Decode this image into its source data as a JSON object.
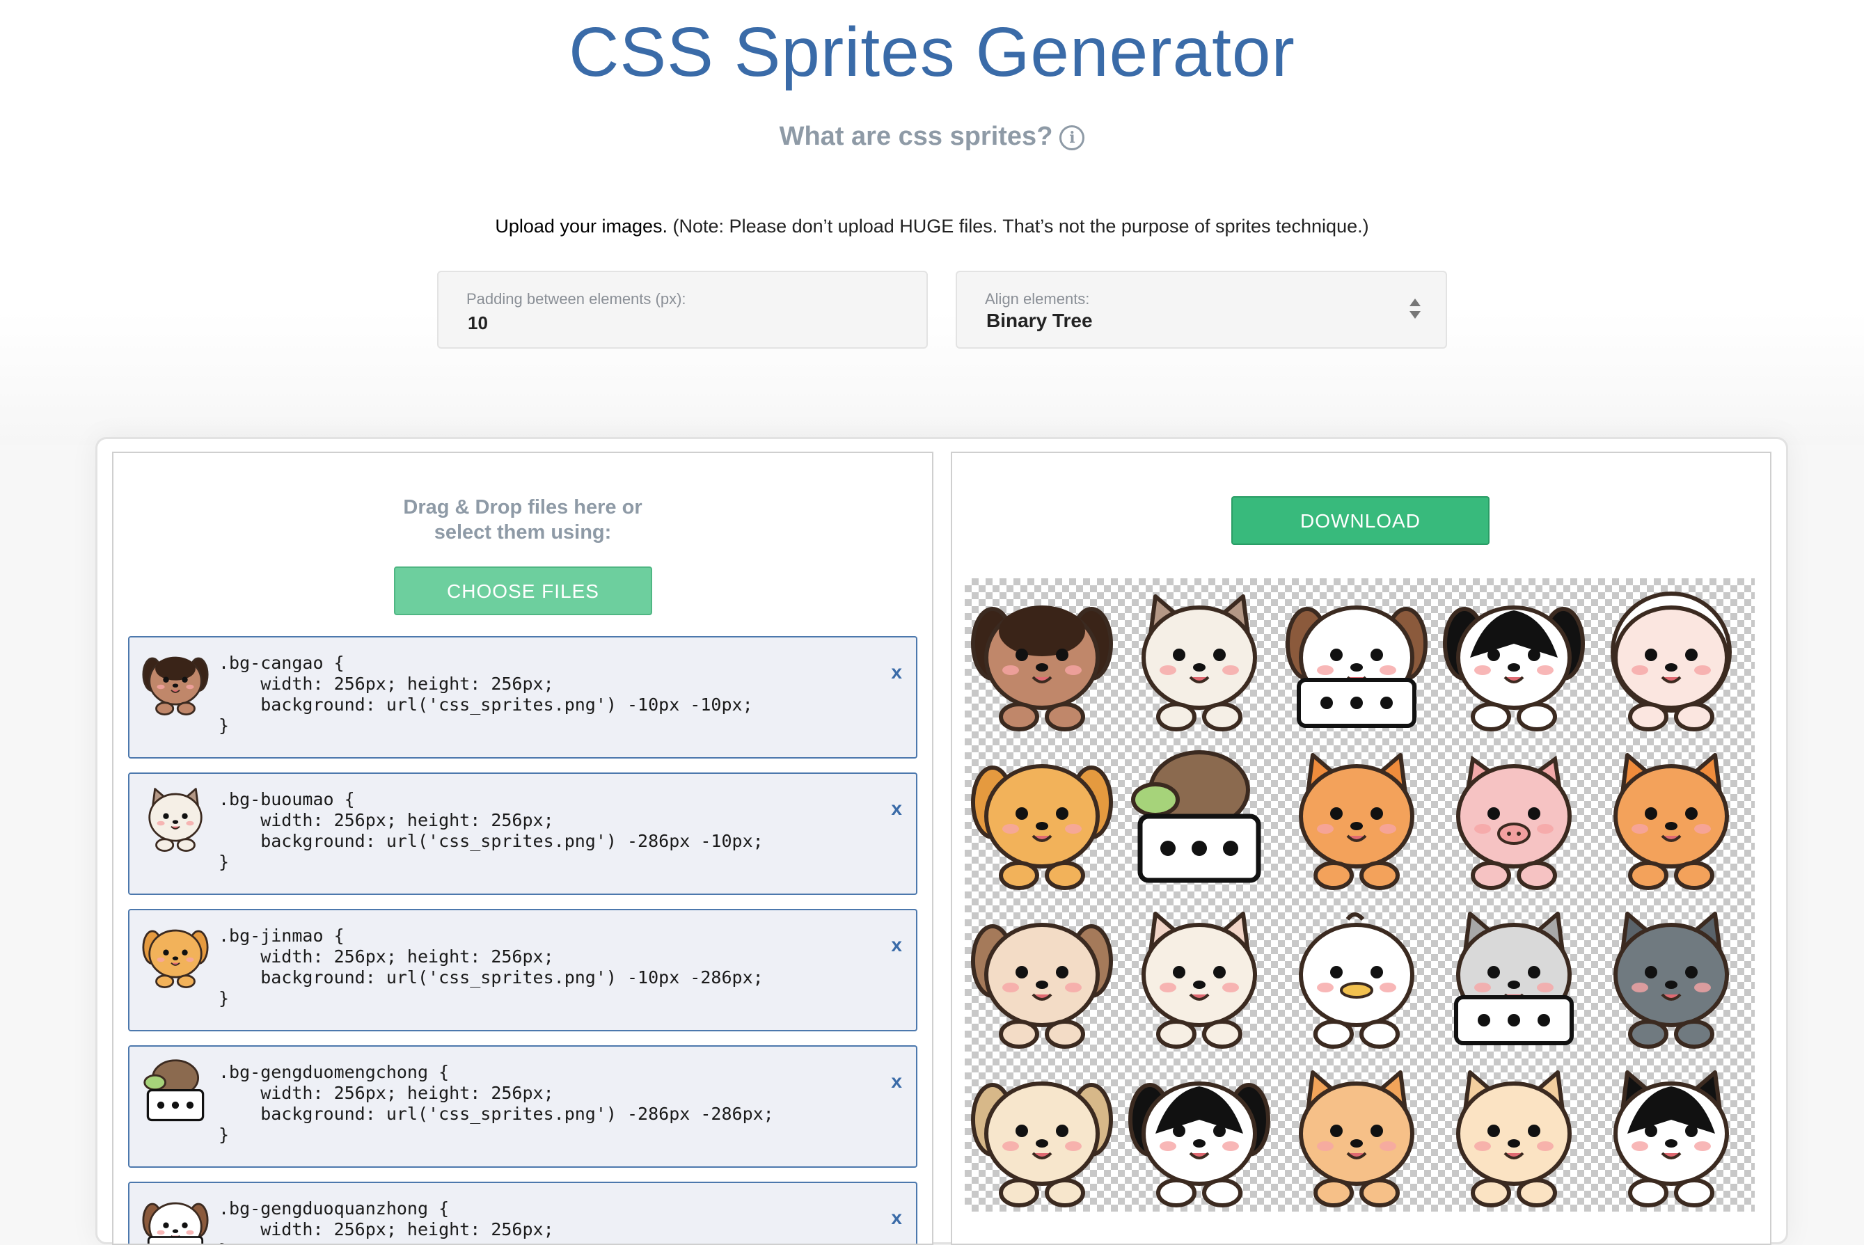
{
  "header": {
    "title": "CSS Sprites Generator",
    "subtitle": "What are css sprites?",
    "note_strong": "Upload your images.",
    "note_rest": " (Note: Please don’t upload HUGE files. That’s not the purpose of sprites technique.)"
  },
  "settings": {
    "padding_label": "Padding between elements (px):",
    "padding_value": "10",
    "align_label": "Align elements:",
    "align_value": "Binary Tree"
  },
  "upload_panel": {
    "drop_line1": "Drag & Drop files here or",
    "drop_line2": "select them using:",
    "choose_button": "CHOOSE FILES",
    "remove_label": "x",
    "items": [
      {
        "icon": "rottweiler-puppy-icon",
        "code": ".bg-cangao {\n    width: 256px; height: 256px;\n    background: url('css_sprites.png') -10px -10px;\n}"
      },
      {
        "icon": "ragdoll-cat-icon",
        "code": ".bg-buoumao {\n    width: 256px; height: 256px;\n    background: url('css_sprites.png') -286px -10px;\n}"
      },
      {
        "icon": "golden-retriever-icon",
        "code": ".bg-jinmao {\n    width: 256px; height: 256px;\n    background: url('css_sprites.png') -10px -286px;\n}"
      },
      {
        "icon": "turtle-icon",
        "code": ".bg-gengduomengchong {\n    width: 256px; height: 256px;\n    background: url('css_sprites.png') -286px -286px;\n}"
      },
      {
        "icon": "puppy-icon",
        "code": ".bg-gengduoquanzhong {\n    width: 256px; height: 256px;\n}"
      }
    ]
  },
  "preview_panel": {
    "download_button": "DOWNLOAD",
    "sprites": [
      {
        "name": "rottweiler-sprite",
        "kind": "dog",
        "face": "#c0876a",
        "ear": "#3a2418",
        "dark": true
      },
      {
        "name": "ragdoll-cat-sprite",
        "kind": "cat",
        "face": "#f5efe6",
        "ear": "#b49886"
      },
      {
        "name": "beagle-sprite",
        "kind": "box-dog",
        "face": "#ffffff",
        "ear": "#8b5a3c"
      },
      {
        "name": "husky-sprite",
        "kind": "dog",
        "face": "#ffffff",
        "ear": "#111111",
        "mask": true
      },
      {
        "name": "sheep-sprite",
        "kind": "sheep",
        "face": "#fbe6e0",
        "ear": "#ffffff"
      },
      {
        "name": "golden-retriever-sprite",
        "kind": "dog",
        "face": "#f2b25a",
        "ear": "#e59a3f"
      },
      {
        "name": "turtle-sprite",
        "kind": "turtle",
        "face": "#8b6a4f",
        "ear": "#a6d37a"
      },
      {
        "name": "shiba-sprite",
        "kind": "fox",
        "face": "#f3a25b",
        "ear": "#f08c3c"
      },
      {
        "name": "pig-sprite",
        "kind": "pig",
        "face": "#f6c3c3",
        "ear": "#f2a9a9"
      },
      {
        "name": "corgi-sprite",
        "kind": "fox",
        "face": "#f3a25b",
        "ear": "#f08c3c"
      },
      {
        "name": "brown-dog-sprite",
        "kind": "dog",
        "face": "#f3dcc6",
        "ear": "#a57a5a"
      },
      {
        "name": "bulldog-sprite",
        "kind": "cat",
        "face": "#f7efe4",
        "ear": "#f2d5c8"
      },
      {
        "name": "duck-sprite",
        "kind": "duck",
        "face": "#ffffff",
        "ear": "#f2c14f"
      },
      {
        "name": "tabby-box-sprite",
        "kind": "box-cat",
        "face": "#d9d9d9",
        "ear": "#a8a8a8"
      },
      {
        "name": "gray-cat-sprite",
        "kind": "cat",
        "face": "#707a80",
        "ear": "#5a636a"
      },
      {
        "name": "hamster-sprite",
        "kind": "hamster",
        "face": "#f7e6cc",
        "ear": "#d7b889"
      },
      {
        "name": "border-collie-sprite",
        "kind": "dog",
        "face": "#ffffff",
        "ear": "#111111",
        "mask": true
      },
      {
        "name": "orange-cat-sprite",
        "kind": "cat",
        "face": "#f6c088",
        "ear": "#f2a45a"
      },
      {
        "name": "pomeranian-sprite",
        "kind": "fox",
        "face": "#fbe3c3",
        "ear": "#f3cf9f"
      },
      {
        "name": "tuxedo-cat-sprite",
        "kind": "cat",
        "face": "#ffffff",
        "ear": "#111111",
        "mask": true
      }
    ]
  },
  "colors": {
    "primary": "#3a6ba8",
    "success": "#38ba7c",
    "item_border": "#4c78ad"
  }
}
